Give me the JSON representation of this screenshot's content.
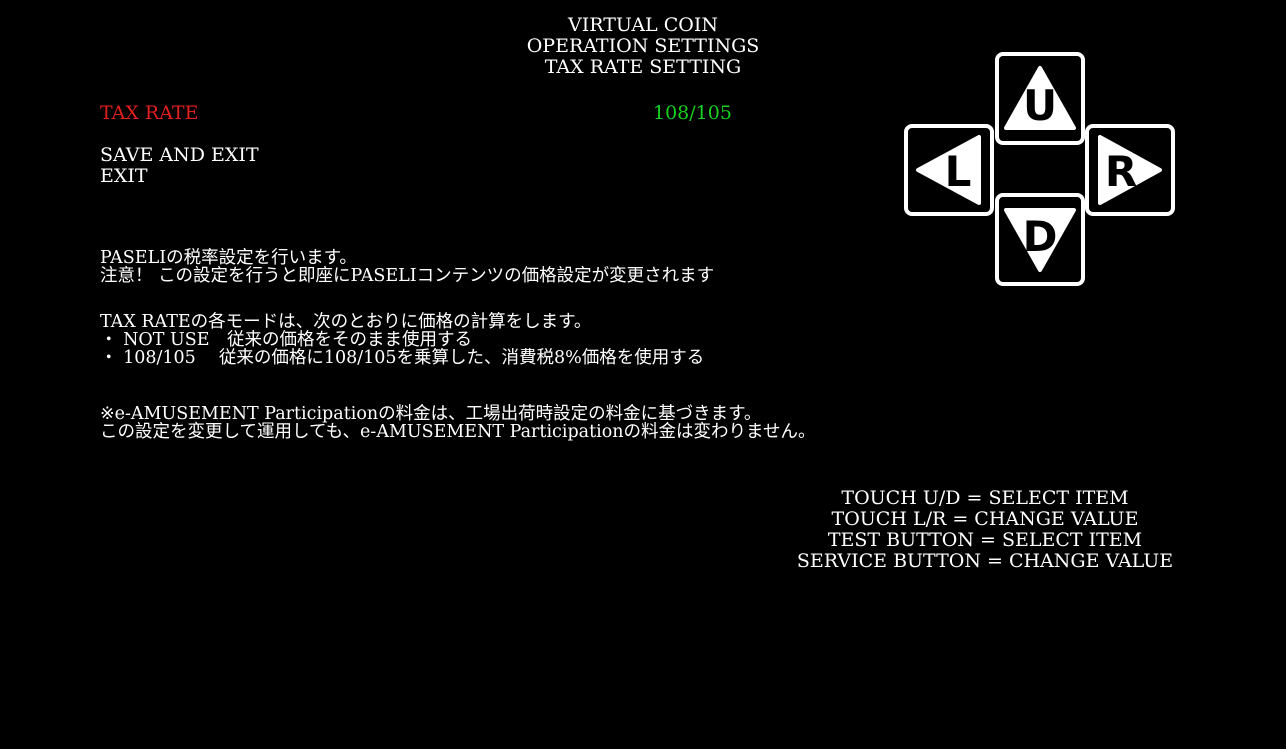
{
  "header": {
    "line1": "VIRTUAL COIN",
    "line2": "OPERATION SETTINGS",
    "line3": "TAX RATE SETTING"
  },
  "menu": {
    "tax_rate_label": "TAX RATE",
    "tax_rate_value": "108/105",
    "save_and_exit": "SAVE AND EXIT",
    "exit": "EXIT"
  },
  "info": {
    "line1": "PASELIの税率設定を行います。",
    "line2": "注意！ この設定を行うと即座にPASELIコンテンツの価格設定が変更されます",
    "line3": "TAX RATEの各モードは、次のとおりに価格の計算をします。",
    "line4": "・ NOT USE　従来の価格をそのまま使用する",
    "line5": "・ 108/105　 従来の価格に108/105を乗算した、消費税8%価格を使用する",
    "line6": "※e-AMUSEMENT Participationの料金は、工場出荷時設定の料金に基づきます。",
    "line7": "この設定を変更して運用しても、e-AMUSEMENT Participationの料金は変わりません。"
  },
  "controls": {
    "line1": "TOUCH U/D = SELECT ITEM",
    "line2": "TOUCH L/R = CHANGE VALUE",
    "line3": "TEST BUTTON = SELECT ITEM",
    "line4": "SERVICE BUTTON = CHANGE VALUE"
  },
  "dpad": {
    "up": "U",
    "left": "L",
    "right": "R",
    "down": "D"
  },
  "colors": {
    "background": "#000000",
    "text": "#ffffff",
    "selected_item": "#e11f1f",
    "value": "#14d21e"
  }
}
